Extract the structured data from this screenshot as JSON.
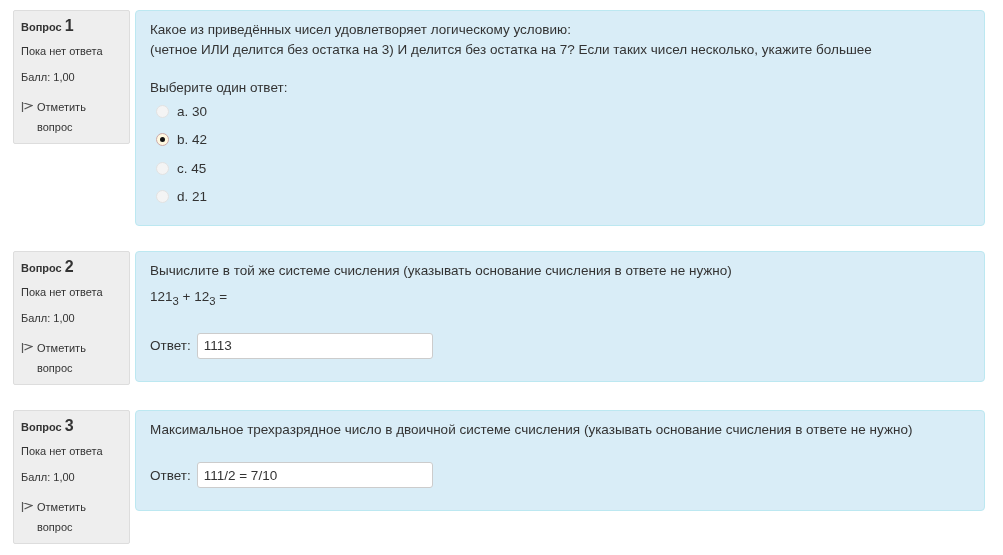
{
  "questions": [
    {
      "kind": "multichoice",
      "label": "Вопрос",
      "number": "1",
      "status": "Пока нет ответа",
      "grade": "Балл: 1,00",
      "flag": "Отметить вопрос",
      "text": [
        "Какое из приведённых чисел  удовлетворяет логическому условию:",
        "(четное ИЛИ делится без остатка на 3) И делится без остатка на 7? Если таких чисел несколько, укажите большее"
      ],
      "prompt": "Выберите один ответ:",
      "options": [
        {
          "label": "a. 30",
          "selected": false
        },
        {
          "label": "b. 42",
          "selected": true
        },
        {
          "label": "c. 45",
          "selected": false
        },
        {
          "label": "d. 21",
          "selected": false
        }
      ]
    },
    {
      "kind": "shortanswer",
      "label": "Вопрос",
      "number": "2",
      "status": "Пока нет ответа",
      "grade": "Балл: 1,00",
      "flag": "Отметить вопрос",
      "text": [
        "Вычислите в той же системе счисления  (указывать основание счисления в ответе не нужно)",
        "121$_{3}$ + 12$_{3}$ ="
      ],
      "answer_label": "Ответ:",
      "answer": "1113"
    },
    {
      "kind": "shortanswer",
      "label": "Вопрос",
      "number": "3",
      "status": "Пока нет ответа",
      "grade": "Балл: 1,00",
      "flag": "Отметить вопрос",
      "text": [
        "Максимальное трехразрядное число в двоичной системе счисления (указывать основание счисления в ответе не нужно)"
      ],
      "answer_label": "Ответ:",
      "answer": "111/2 = 7/10"
    }
  ]
}
